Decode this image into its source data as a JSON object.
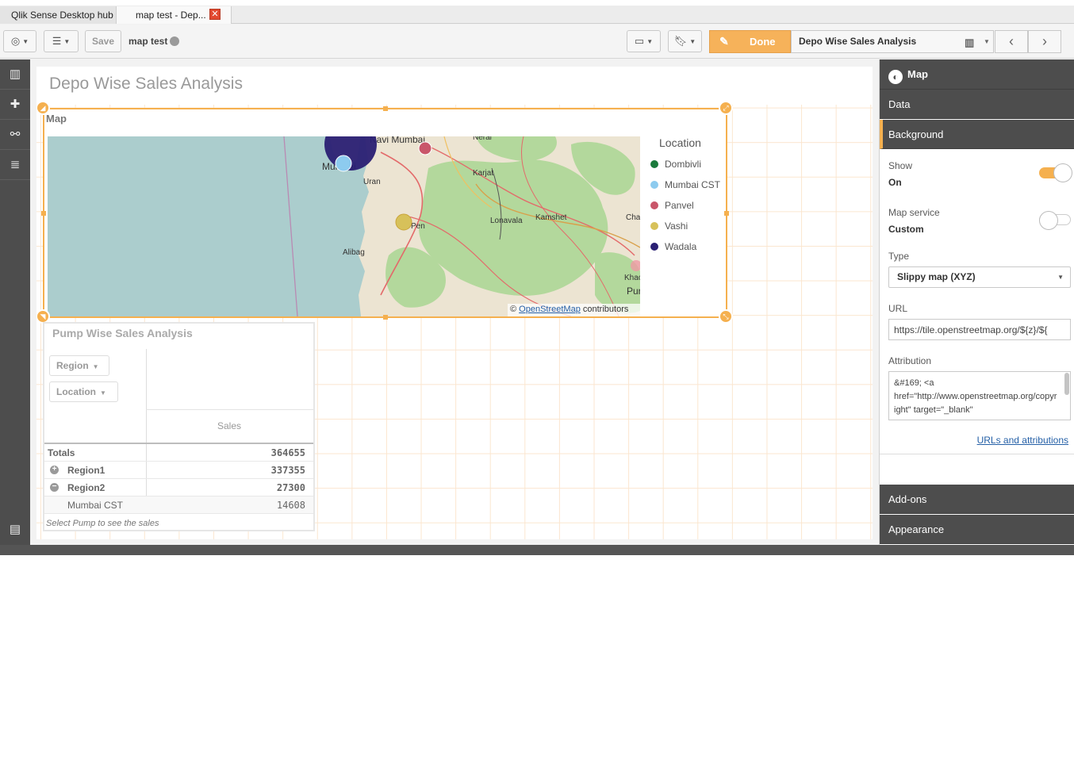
{
  "tabs": {
    "hub": "Qlik Sense Desktop hub",
    "current": "map test - Dep..."
  },
  "toolbar": {
    "save_label": "Save",
    "app_name": "map test",
    "done_label": "Done",
    "sheet_name": "Depo Wise Sales Analysis"
  },
  "sheet": {
    "title": "Depo Wise Sales Analysis"
  },
  "map": {
    "label": "Map",
    "legend_title": "Location",
    "legend": [
      {
        "name": "Dombivli",
        "color": "#1a7a3c"
      },
      {
        "name": "Mumbai CST",
        "color": "#8dcbef"
      },
      {
        "name": "Panvel",
        "color": "#c9566a"
      },
      {
        "name": "Vashi",
        "color": "#d7c15a"
      },
      {
        "name": "Wadala",
        "color": "#2a1f73"
      }
    ],
    "places": [
      "Navi Mumbai",
      "Neral",
      "Mumbai",
      "Karjat",
      "Uran",
      "Lonavala",
      "Kamshet",
      "Pen",
      "Alibag",
      "Cha",
      "Khac",
      "Pur"
    ],
    "attribution_prefix": "©",
    "attribution_link": "OpenStreetMap",
    "attribution_suffix": "contributors"
  },
  "pivot": {
    "title": "Pump Wise Sales Analysis",
    "dimensions": [
      "Region",
      "Location"
    ],
    "measure_header": "Sales",
    "rows": [
      {
        "label": "Totals",
        "value": "364655",
        "bold": true
      },
      {
        "label": "Region1",
        "value": "337355",
        "bold": true,
        "expander": "+"
      },
      {
        "label": "Region2",
        "value": "27300",
        "bold": true,
        "expander": "−"
      },
      {
        "label": "Mumbai CST",
        "value": "14608",
        "bold": false
      }
    ],
    "footer": "Select Pump to see the sales"
  },
  "properties": {
    "header": "Map",
    "sections": {
      "data": "Data",
      "background": "Background",
      "addons": "Add-ons",
      "appearance": "Appearance"
    },
    "show_label": "Show",
    "show_value": "On",
    "map_service_label": "Map service",
    "map_service_value": "Custom",
    "type_label": "Type",
    "type_value": "Slippy map (XYZ)",
    "url_label": "URL",
    "url_value": "https://tile.openstreetmap.org/${z}/${",
    "attribution_label": "Attribution",
    "attribution_value": "&#169; <a href=\"http://www.openstreetmap.org/copyright\" target=\"_blank\"",
    "urls_link": "URLs and attributions"
  },
  "colors": {
    "accent": "#f5b04f",
    "dark_panel": "#4d4d4d",
    "water": "#abcdcd",
    "land": "#eee8d8",
    "forest": "#a9d08e"
  }
}
